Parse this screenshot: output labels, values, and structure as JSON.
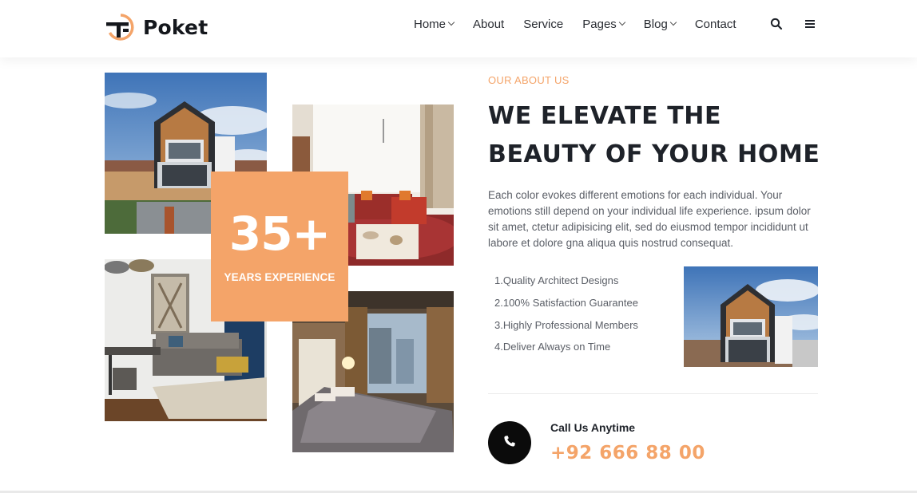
{
  "brand": {
    "name": "Poket",
    "accent": "#f4a469"
  },
  "nav": {
    "items": [
      {
        "label": "Home",
        "dropdown": true
      },
      {
        "label": "About",
        "dropdown": false
      },
      {
        "label": "Service",
        "dropdown": false
      },
      {
        "label": "Pages",
        "dropdown": true
      },
      {
        "label": "Blog",
        "dropdown": true
      },
      {
        "label": "Contact",
        "dropdown": false
      }
    ],
    "icons": [
      "search-icon",
      "menu-icon"
    ]
  },
  "experience": {
    "number": "35+",
    "label": "YEARS EXPERIENCE"
  },
  "about": {
    "eyebrow": "OUR ABOUT US",
    "headline": "WE ELEVATE THE BEAUTY OF YOUR HOME",
    "description": "Each color evokes different emotions for each individual. Your emotions still depend on your individual life experience. ipsum dolor sit amet, ctetur adipisicing elit, sed do eiusmod tempor incididunt ut labore et dolore gna aliqua quis nostrud consequat.",
    "features": [
      "1.Quality Architect Designs",
      "2.100% Satisfaction Guarantee",
      "3.Highly Professional Members",
      "4.Deliver Always on Time"
    ]
  },
  "contact": {
    "label": "Call Us Anytime",
    "phone": "+92 666 88 00",
    "icon": "phone-icon"
  }
}
